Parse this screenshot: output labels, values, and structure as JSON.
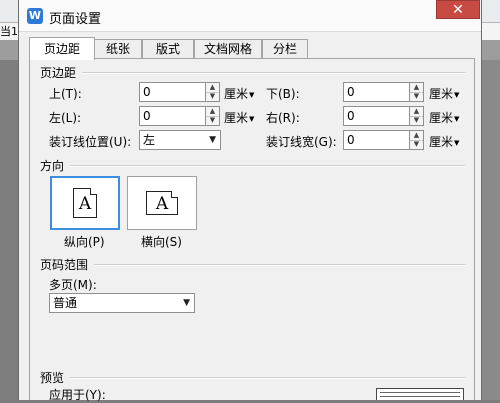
{
  "background": {
    "left_tab_text": "当1"
  },
  "dialog": {
    "title": "页面设置",
    "app_icon_letter": "W",
    "close_glyph": "✕"
  },
  "tabs": [
    {
      "label": "页边距",
      "active": true
    },
    {
      "label": "纸张",
      "active": false
    },
    {
      "label": "版式",
      "active": false
    },
    {
      "label": "文档网格",
      "active": false
    },
    {
      "label": "分栏",
      "active": false
    }
  ],
  "margins": {
    "section_title": "页边距",
    "top": {
      "label": "上(T):",
      "value": "0",
      "unit": "厘米"
    },
    "bottom": {
      "label": "下(B):",
      "value": "0",
      "unit": "厘米"
    },
    "left": {
      "label": "左(L):",
      "value": "0",
      "unit": "厘米"
    },
    "right": {
      "label": "右(R):",
      "value": "0",
      "unit": "厘米"
    },
    "gutter_pos": {
      "label": "装订线位置(U):",
      "value": "左"
    },
    "gutter": {
      "label": "装订线宽(G):",
      "value": "0",
      "unit": "厘米"
    }
  },
  "orientation": {
    "section_title": "方向",
    "portrait": {
      "label": "纵向(P)",
      "glyph": "A",
      "selected": true
    },
    "landscape": {
      "label": "横向(S)",
      "glyph": "A",
      "selected": false
    }
  },
  "page_range": {
    "section_title": "页码范围",
    "multi_label": "多页(M):",
    "multi_value": "普通"
  },
  "preview": {
    "section_title": "预览",
    "apply_label": "应用于(Y):"
  },
  "icons": {
    "spin_up": "▲",
    "spin_down": "▼",
    "caret": "▼"
  }
}
